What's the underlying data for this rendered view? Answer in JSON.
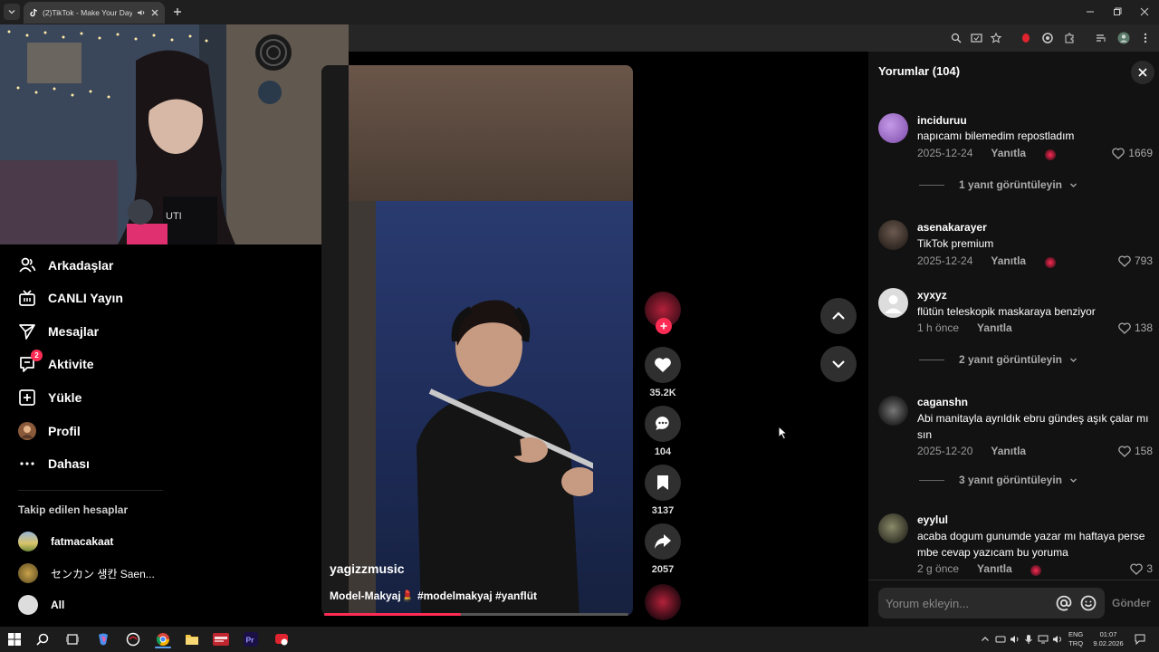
{
  "browser": {
    "tab_title": "(2)TikTok - Make Your Day"
  },
  "sidebar": {
    "nav": [
      {
        "label": "Arkadaşlar",
        "icon": "friends-icon"
      },
      {
        "label": "CANLI Yayın",
        "icon": "live-icon"
      },
      {
        "label": "Mesajlar",
        "icon": "messages-icon"
      },
      {
        "label": "Aktivite",
        "icon": "activity-icon",
        "badge": "2"
      },
      {
        "label": "Yükle",
        "icon": "upload-icon"
      },
      {
        "label": "Profil",
        "icon": "profile-avatar"
      },
      {
        "label": "Dahası",
        "icon": "more-icon"
      }
    ],
    "following_heading": "Takip edilen hesaplar",
    "following": [
      {
        "name": "fatmacakaat"
      },
      {
        "name": "センカン 생칸 Saen..."
      },
      {
        "name": "All"
      }
    ]
  },
  "video": {
    "username": "yagizzmusic",
    "caption": "Model-Makyaj💄 #modelmakyaj #yanflüt",
    "progress": 0.45,
    "likes": "35.2K",
    "comments": "104",
    "saves": "3137",
    "shares": "2057"
  },
  "comments_panel": {
    "title": "Yorumlar",
    "count": "(104)",
    "items": [
      {
        "user": "inciduruu",
        "text": "napıcamı bilemedim repostladım",
        "date": "2025-12-24",
        "reply": "Yanıtla",
        "likes": "1669",
        "view_replies": "1 yanıt görüntüleyin"
      },
      {
        "user": "asenakarayer",
        "text": "TikTok premium",
        "date": "2025-12-24",
        "reply": "Yanıtla",
        "likes": "793"
      },
      {
        "user": "xyxyz",
        "text": "flütün teleskopik maskaraya benziyor",
        "date": "1 h önce",
        "reply": "Yanıtla",
        "likes": "138",
        "view_replies": "2 yanıt görüntüleyin"
      },
      {
        "user": "caganshn",
        "text": "Abi manitayla ayrıldık ebru gündeş aşık çalar mı sın",
        "date": "2025-12-20",
        "reply": "Yanıtla",
        "likes": "158",
        "view_replies": "3 yanıt görüntüleyin"
      },
      {
        "user": "eyylul",
        "text": "acaba dogum gunumde yazar mı haftaya perse mbe cevap yazıcam bu yoruma",
        "date": "2 g önce",
        "reply": "Yanıtla",
        "likes": "3"
      }
    ],
    "input_placeholder": "Yorum ekleyin...",
    "send_label": "Gönder"
  },
  "taskbar": {
    "lang_top": "ENG",
    "lang_bottom": "TRQ",
    "time": "01:07",
    "date": "9.02.2026"
  },
  "colors": {
    "accent": "#fe2c55",
    "panel_bg": "#121212",
    "page_bg": "#000000"
  }
}
